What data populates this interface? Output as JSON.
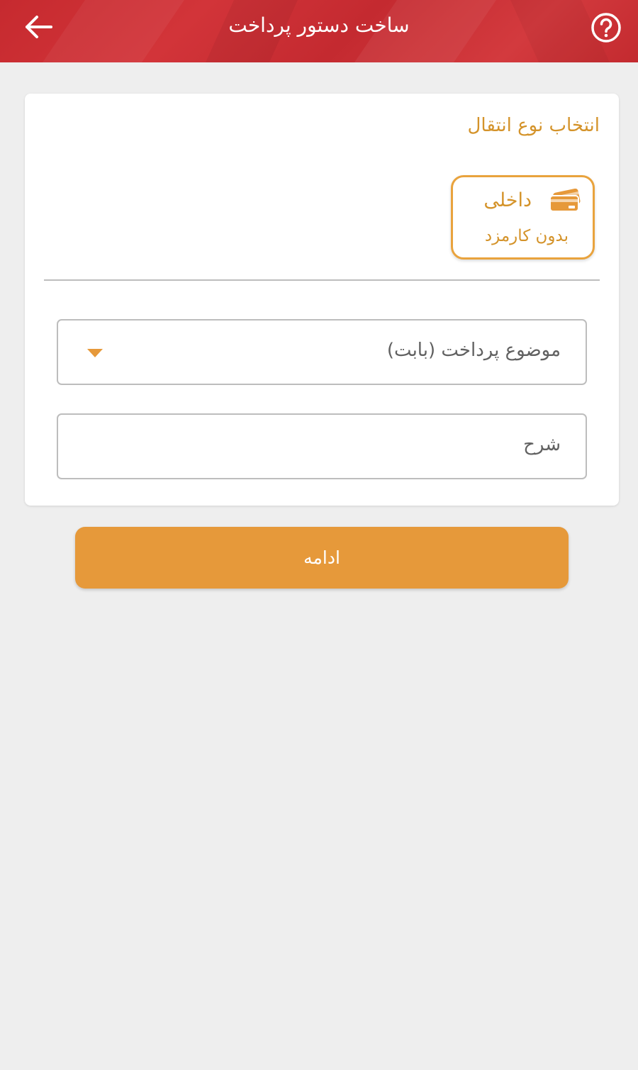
{
  "header": {
    "title": "ساخت دستور پرداخت",
    "back_icon": "arrow-left-icon",
    "help_icon": "question-circle-icon"
  },
  "transfer_type": {
    "section_title": "انتخاب نوع انتقال",
    "option": {
      "title": "داخلی",
      "subtitle": "بدون کارمزد",
      "icon": "cards-icon"
    }
  },
  "form": {
    "subject_placeholder": "موضوع پرداخت (بابت)",
    "description_placeholder": "شرح"
  },
  "actions": {
    "continue_label": "ادامه"
  },
  "colors": {
    "header": "#c62a2f",
    "accent": "#e6993a",
    "accent_text": "#d4932a",
    "background": "#eeeeee"
  }
}
